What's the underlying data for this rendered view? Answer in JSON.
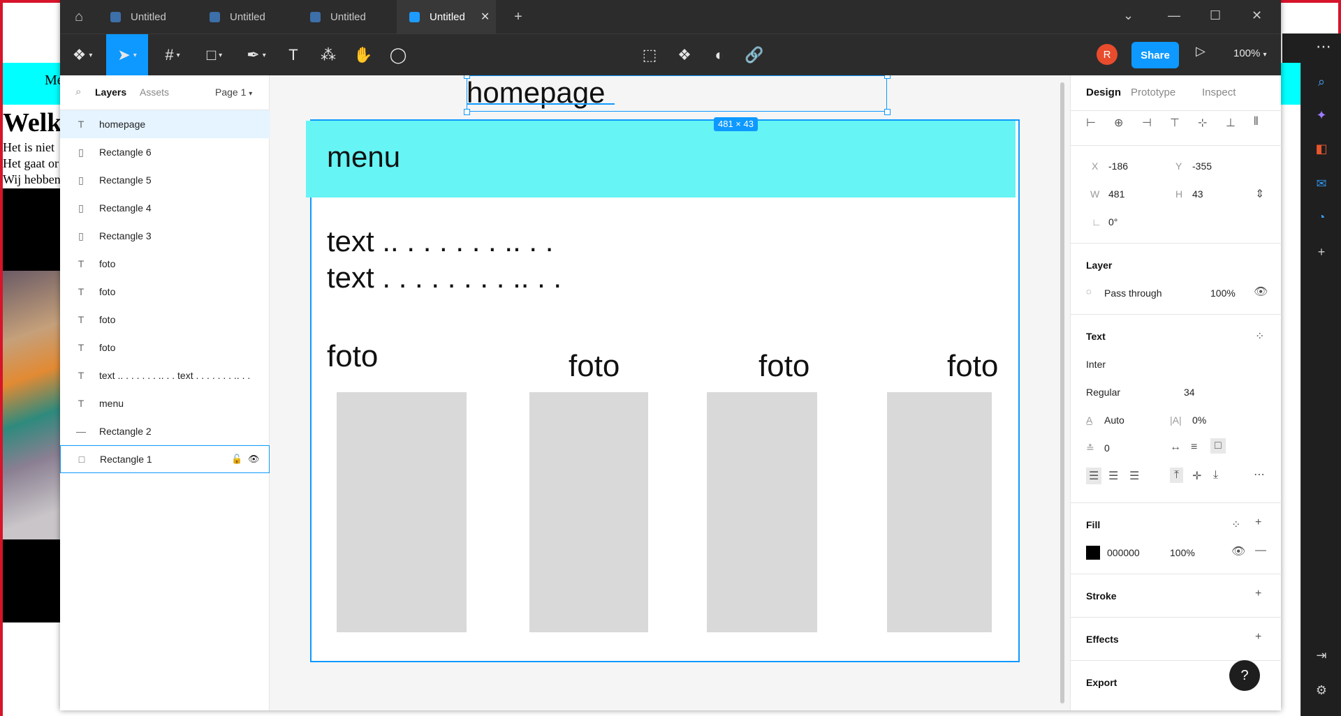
{
  "browser_bg": {
    "menu_text": "Me",
    "welcome_text": "Welk",
    "lines": [
      "Het is niet",
      "Het gaat or",
      "Wij hebben"
    ]
  },
  "tabs": [
    {
      "label": "Untitled",
      "active": false
    },
    {
      "label": "Untitled",
      "active": false
    },
    {
      "label": "Untitled",
      "active": false
    },
    {
      "label": "Untitled",
      "active": true
    }
  ],
  "toolbar": {
    "avatar_initial": "R",
    "share_label": "Share",
    "zoom_label": "100%"
  },
  "left_panel": {
    "tab_layers": "Layers",
    "tab_assets": "Assets",
    "page_label": "Page 1",
    "layers": [
      {
        "name": "homepage",
        "icon": "T",
        "highlighted": true
      },
      {
        "name": "Rectangle 6",
        "icon": "▯"
      },
      {
        "name": "Rectangle 5",
        "icon": "▯"
      },
      {
        "name": "Rectangle 4",
        "icon": "▯"
      },
      {
        "name": "Rectangle 3",
        "icon": "▯"
      },
      {
        "name": "foto",
        "icon": "T"
      },
      {
        "name": "foto",
        "icon": "T"
      },
      {
        "name": "foto",
        "icon": "T"
      },
      {
        "name": "foto",
        "icon": "T"
      },
      {
        "name": "text .. . . . . . . .. . . text . . . . . . . .. . .",
        "icon": "T"
      },
      {
        "name": "menu",
        "icon": "T"
      },
      {
        "name": "Rectangle 2",
        "icon": "—"
      },
      {
        "name": "Rectangle 1",
        "icon": "□",
        "selected": true
      }
    ]
  },
  "canvas": {
    "title_text": "homepage",
    "dimension_badge": "481 × 43",
    "menu_text": "menu",
    "body_line_1": "text .. . . . . . . .. . .",
    "body_line_2": "text . . . . . . . . .. . .",
    "foto_labels": [
      "foto",
      "foto",
      "foto",
      "foto"
    ]
  },
  "right_panel": {
    "tab_design": "Design",
    "tab_prototype": "Prototype",
    "tab_inspect": "Inspect",
    "x_label": "X",
    "x_value": "-186",
    "y_label": "Y",
    "y_value": "-355",
    "w_label": "W",
    "w_value": "481",
    "h_label": "H",
    "h_value": "43",
    "rotation_value": "0°",
    "layer_section": "Layer",
    "blend_mode": "Pass through",
    "layer_opacity": "100%",
    "text_section": "Text",
    "font_family": "Inter",
    "font_style": "Regular",
    "font_size": "34",
    "line_height": "Auto",
    "letter_spacing": "0%",
    "paragraph_spacing": "0",
    "fill_section": "Fill",
    "fill_hex": "000000",
    "fill_opacity": "100%",
    "stroke_section": "Stroke",
    "effects_section": "Effects",
    "export_section": "Export"
  },
  "colors": {
    "accent": "#0d99ff",
    "menu_fill": "#66f4f4",
    "placeholder_rect": "#d9d9d9",
    "share": "#0d99ff",
    "avatar": "#e84c2d"
  }
}
